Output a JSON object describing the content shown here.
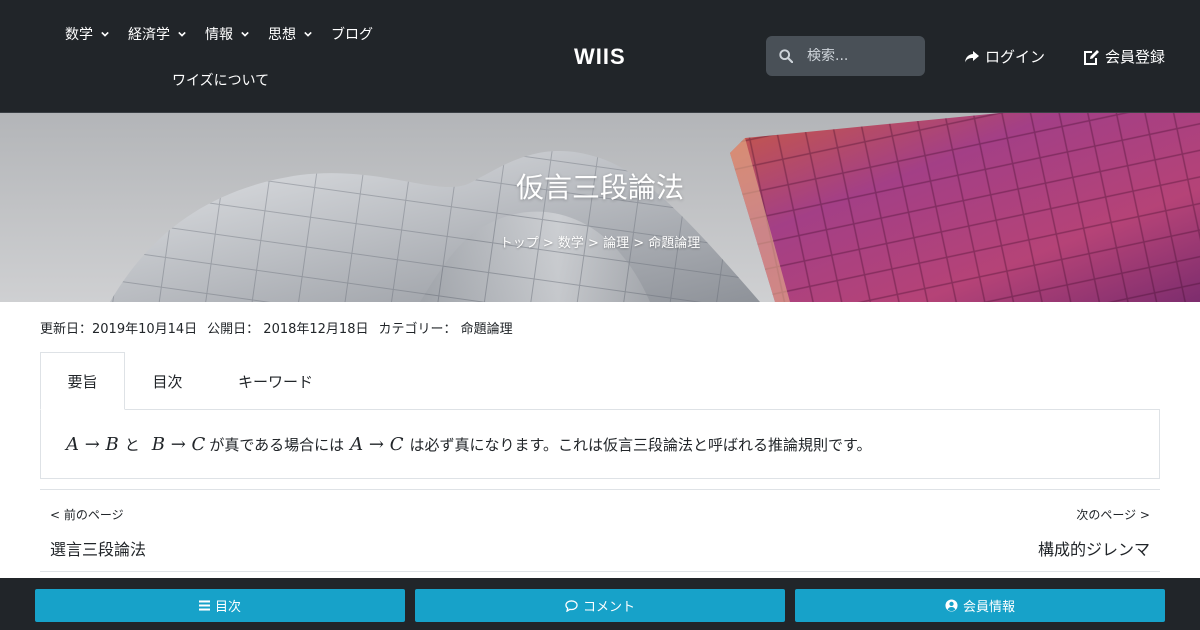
{
  "nav": {
    "items": [
      {
        "label": "数学",
        "has_dropdown": true
      },
      {
        "label": "経済学",
        "has_dropdown": true
      },
      {
        "label": "情報",
        "has_dropdown": true
      },
      {
        "label": "思想",
        "has_dropdown": true
      },
      {
        "label": "ブログ",
        "has_dropdown": false
      }
    ],
    "about": "ワイズについて"
  },
  "header": {
    "logo": "WIIS",
    "search_placeholder": "検索...",
    "login": "ログイン",
    "register": "会員登録"
  },
  "hero": {
    "title": "仮言三段論法",
    "breadcrumb": [
      "トップ",
      "数学",
      "論理",
      "命題論理"
    ],
    "separator": ">"
  },
  "meta": {
    "updated": "更新日：2019年10月14日",
    "published": "公開日： 2018年12月18日",
    "category_label": "カテゴリー：",
    "category": "命題論理"
  },
  "tabs": [
    {
      "label": "要旨",
      "active": true
    },
    {
      "label": "目次",
      "active": false
    },
    {
      "label": "キーワード",
      "active": false
    }
  ],
  "summary": {
    "expr1": "A → B",
    "and": "と",
    "expr2": "B → C",
    "text1": "が真である場合には",
    "expr3": "A → C",
    "text2": "は必ず真になります。これは仮言三段論法と呼ばれる推論規則です。"
  },
  "pager": {
    "prev_label": "< 前のページ",
    "prev_title": "選言三段論法",
    "next_label": "次のページ >",
    "next_title": "構成的ジレンマ"
  },
  "bottom_bar": {
    "toc": "目次",
    "comment": "コメント",
    "member": "会員情報"
  },
  "colors": {
    "header_bg": "#212529",
    "accent": "#17a2c9"
  }
}
